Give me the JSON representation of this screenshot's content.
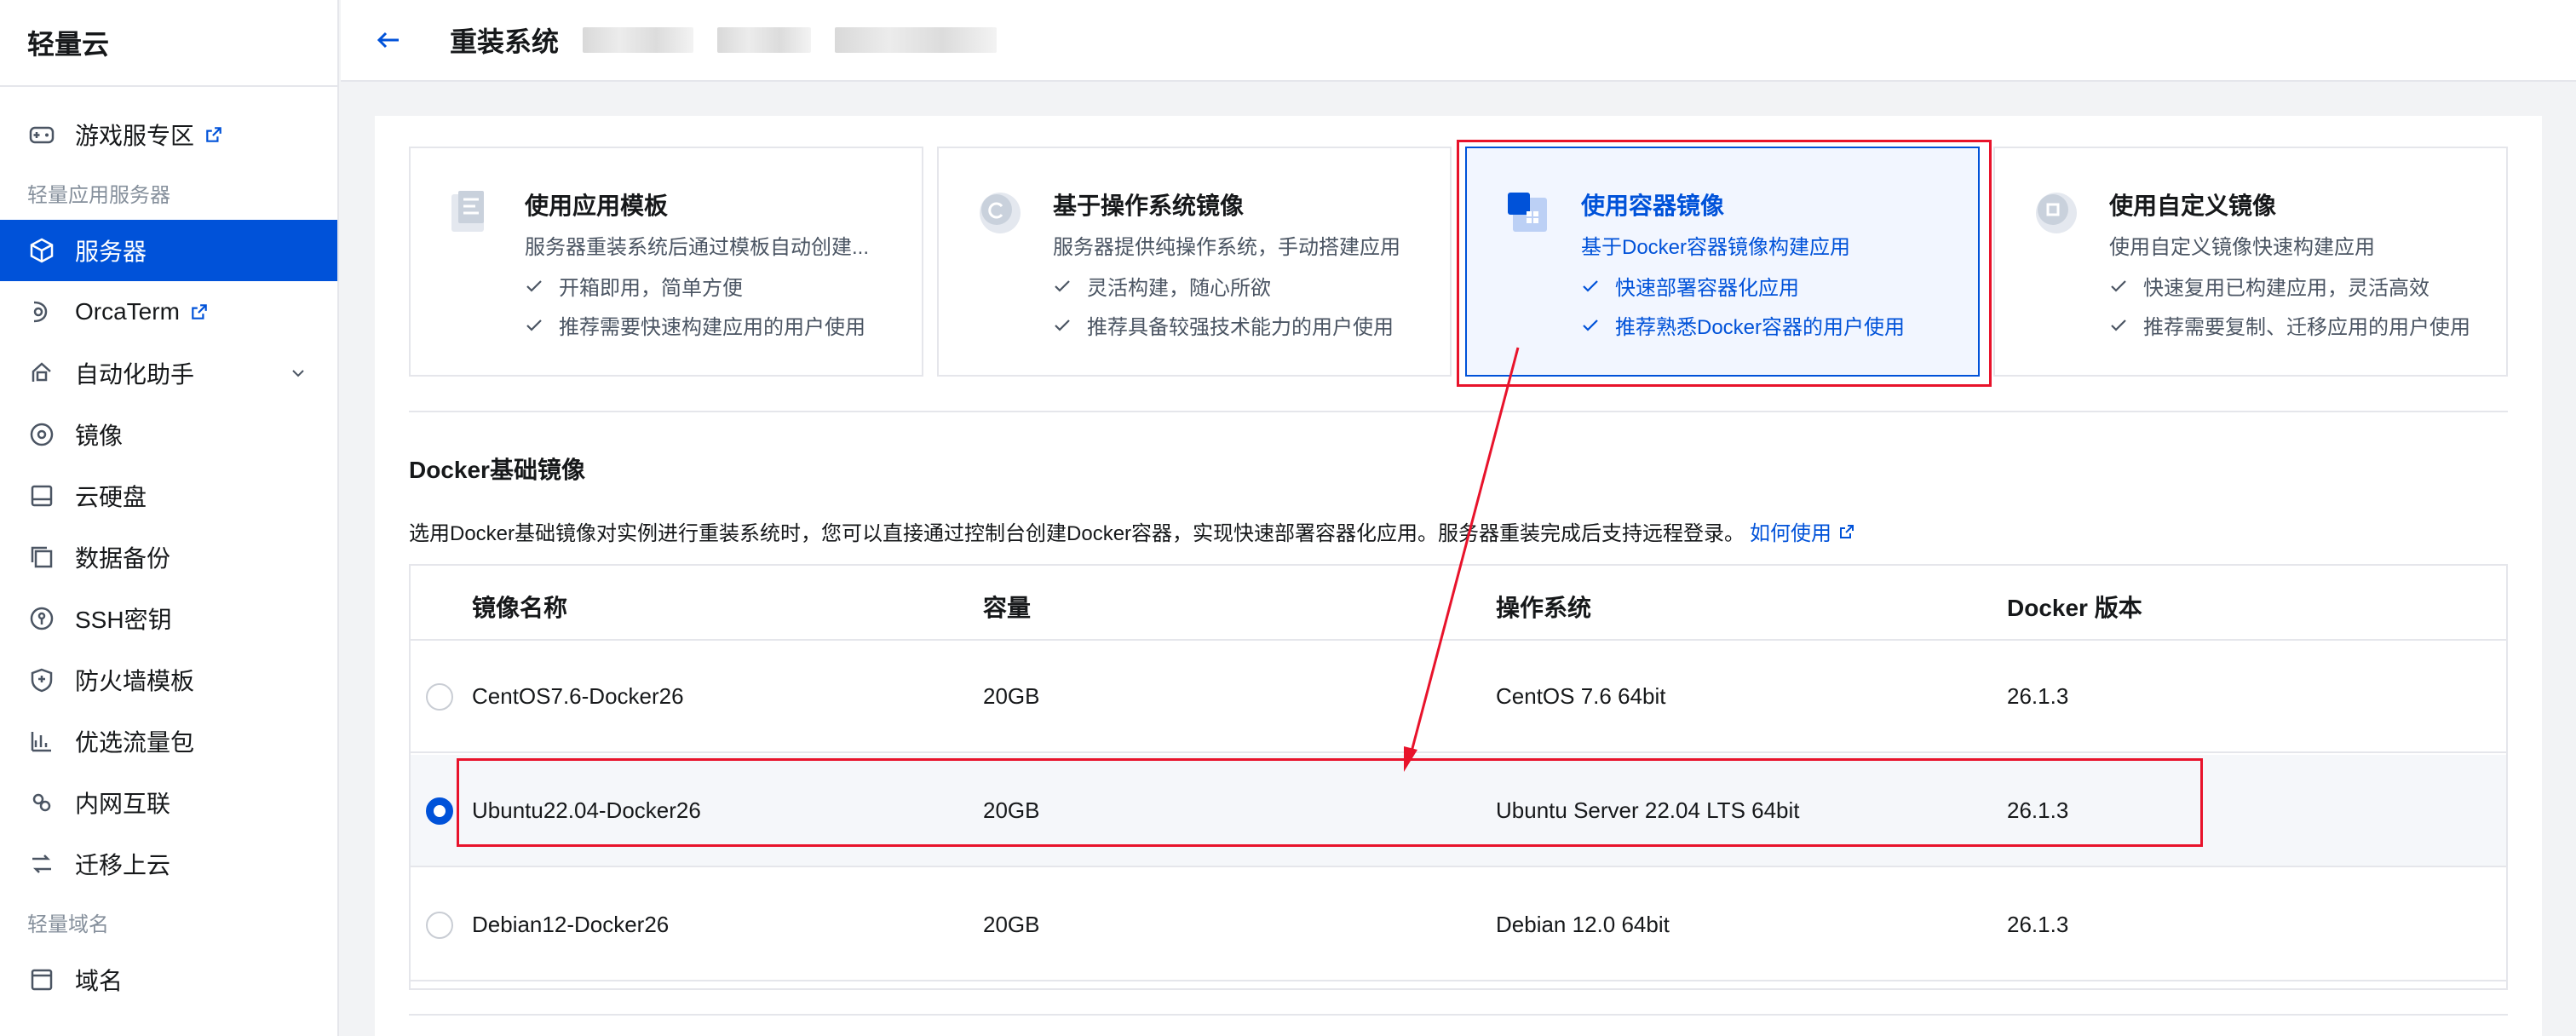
{
  "sidebar": {
    "logo": "轻量云",
    "items": [
      {
        "label": "游戏服专区",
        "icon": "gamepad-icon",
        "external": true
      },
      {
        "group": "轻量应用服务器"
      },
      {
        "label": "服务器",
        "icon": "cube-icon",
        "active": true
      },
      {
        "label": "OrcaTerm",
        "icon": "terminal-icon",
        "external": true
      },
      {
        "label": "自动化助手",
        "icon": "robot-icon",
        "expandable": true
      },
      {
        "label": "镜像",
        "icon": "disc-icon"
      },
      {
        "label": "云硬盘",
        "icon": "disk-icon"
      },
      {
        "label": "数据备份",
        "icon": "backup-icon"
      },
      {
        "label": "SSH密钥",
        "icon": "key-icon"
      },
      {
        "label": "防火墙模板",
        "icon": "shield-icon"
      },
      {
        "label": "优选流量包",
        "icon": "chart-icon"
      },
      {
        "label": "内网互联",
        "icon": "network-icon"
      },
      {
        "label": "迁移上云",
        "icon": "migrate-icon"
      },
      {
        "group": "轻量域名"
      },
      {
        "label": "域名",
        "icon": "domain-icon"
      }
    ]
  },
  "header": {
    "title": "重装系统"
  },
  "cards": [
    {
      "title": "使用应用模板",
      "desc": "服务器重装系统后通过模板自动创建...",
      "features": [
        "开箱即用，简单方便",
        "推荐需要快速构建应用的用户使用"
      ],
      "icon": "template-icon"
    },
    {
      "title": "基于操作系统镜像",
      "desc": "服务器提供纯操作系统，手动搭建应用",
      "features": [
        "灵活构建，随心所欲",
        "推荐具备较强技术能力的用户使用"
      ],
      "icon": "os-image-icon"
    },
    {
      "title": "使用容器镜像",
      "desc": "基于Docker容器镜像构建应用",
      "features": [
        "快速部署容器化应用",
        "推荐熟悉Docker容器的用户使用"
      ],
      "icon": "container-image-icon",
      "selected": true
    },
    {
      "title": "使用自定义镜像",
      "desc": "使用自定义镜像快速构建应用",
      "features": [
        "快速复用已构建应用，灵活高效",
        "推荐需要复制、迁移应用的用户使用"
      ],
      "icon": "custom-image-icon"
    }
  ],
  "section": {
    "title": "Docker基础镜像",
    "desc": "选用Docker基础镜像对实例进行重装系统时，您可以直接通过控制台创建Docker容器，实现快速部署容器化应用。服务器重装完成后支持远程登录。",
    "link": "如何使用"
  },
  "table": {
    "headers": [
      "镜像名称",
      "容量",
      "操作系统",
      "Docker 版本"
    ],
    "rows": [
      {
        "name": "CentOS7.6-Docker26",
        "size": "20GB",
        "os": "CentOS 7.6 64bit",
        "docker": "26.1.3",
        "selected": false
      },
      {
        "name": "Ubuntu22.04-Docker26",
        "size": "20GB",
        "os": "Ubuntu Server 22.04 LTS 64bit",
        "docker": "26.1.3",
        "selected": true
      },
      {
        "name": "Debian12-Docker26",
        "size": "20GB",
        "os": "Debian 12.0 64bit",
        "docker": "26.1.3",
        "selected": false
      }
    ]
  },
  "colors": {
    "accent": "#0052d9",
    "annotation": "#e8132b"
  }
}
